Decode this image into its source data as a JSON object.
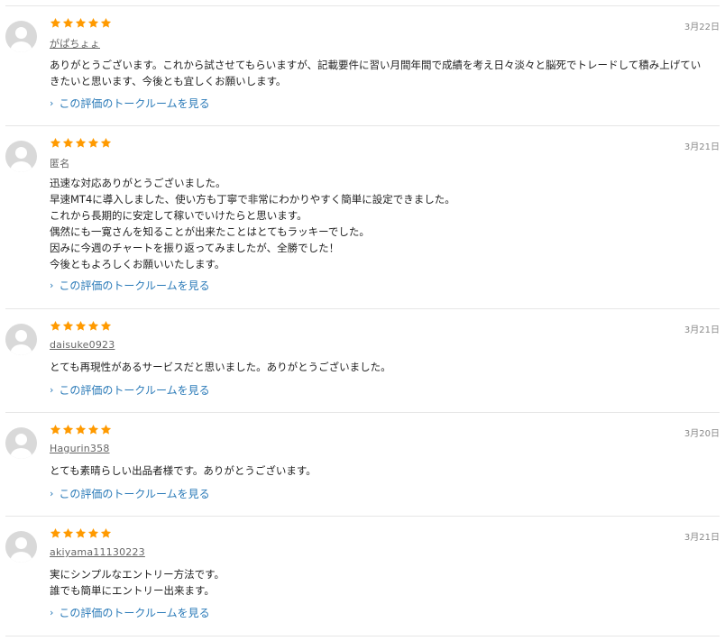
{
  "link_label": "この評価のトークルームを見る",
  "colors": {
    "star": "#ff9a00",
    "link": "#2a7ab8",
    "divider": "#e6e6e6",
    "avatar": "#d9d9d9"
  },
  "reviews": [
    {
      "author": "がぱちょょ",
      "date": "3月22日",
      "rating": 5,
      "lines": [
        "ありがとうございます。これから試させてもらいますが、記載要件に習い月間年間で成績を考え日々淡々と脳死でトレードして積み上げてい",
        "きたいと思います、今後とも宜しくお願いします。"
      ]
    },
    {
      "author": "匿名",
      "date": "3月21日",
      "rating": 5,
      "lines": [
        "迅速な対応ありがとうございました。",
        "早速MT4に導入しました、使い方も丁寧で非常にわかりやすく簡単に設定できました。",
        "これから長期的に安定して稼いでいけたらと思います。",
        "偶然にも一寛さんを知ることが出来たことはとてもラッキーでした。",
        "因みに今週のチャートを振り返ってみましたが、全勝でした！",
        "今後ともよろしくお願いいたします。"
      ]
    },
    {
      "author": "daisuke0923",
      "date": "3月21日",
      "rating": 5,
      "lines": [
        "とても再現性があるサービスだと思いました。ありがとうございました。"
      ]
    },
    {
      "author": "Hagurin358",
      "date": "3月20日",
      "rating": 5,
      "lines": [
        "とても素晴らしい出品者様です。ありがとうございます。"
      ]
    },
    {
      "author": "akiyama11130223",
      "date": "3月21日",
      "rating": 5,
      "lines": [
        "実にシンプルなエントリー方法です。",
        "誰でも簡単にエントリー出来ます。"
      ]
    }
  ]
}
